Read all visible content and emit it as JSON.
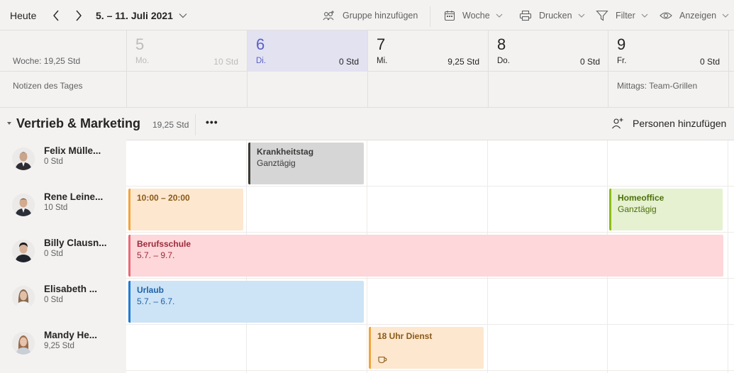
{
  "toolbar": {
    "today_label": "Heute",
    "date_range": "5. – 11. Juli 2021",
    "add_group_label": "Gruppe hinzufügen",
    "view_label": "Woche",
    "print_label": "Drucken",
    "filter_label": "Filter",
    "display_label": "Anzeigen"
  },
  "header": {
    "week_summary": "Woche: 19,25 Std",
    "notes_label": "Notizen des Tages",
    "days": [
      {
        "num": "5",
        "weekday": "Mo.",
        "hours": "10 Std",
        "note": ""
      },
      {
        "num": "6",
        "weekday": "Di.",
        "hours": "0 Std",
        "note": ""
      },
      {
        "num": "7",
        "weekday": "Mi.",
        "hours": "9,25 Std",
        "note": ""
      },
      {
        "num": "8",
        "weekday": "Do.",
        "hours": "0 Std",
        "note": ""
      },
      {
        "num": "9",
        "weekday": "Fr.",
        "hours": "0 Std",
        "note": "Mittags: Team-Grillen"
      }
    ]
  },
  "group": {
    "title": "Vertrieb & Marketing",
    "hours": "19,25 Std",
    "more_label": "•••",
    "add_people_label": "Personen hinzufügen"
  },
  "people": [
    {
      "name": "Felix Mülle...",
      "hours": "0 Std"
    },
    {
      "name": "Rene Leine...",
      "hours": "10 Std"
    },
    {
      "name": "Billy Clausn...",
      "hours": "0 Std"
    },
    {
      "name": "Elisabeth ...",
      "hours": "0 Std"
    },
    {
      "name": "Mandy He...",
      "hours": "9,25 Std"
    }
  ],
  "shifts": {
    "felix_sick": {
      "title": "Krankheitstag",
      "sub": "Ganztägig"
    },
    "rene_shift": {
      "title": "10:00 – 20:00"
    },
    "rene_homeoffice": {
      "title": "Homeoffice",
      "sub": "Ganztägig"
    },
    "billy_school": {
      "title": "Berufsschule",
      "sub": "5.7. – 9.7."
    },
    "elisabeth_vacation": {
      "title": "Urlaub",
      "sub": "5.7. – 6.7."
    },
    "mandy_shift": {
      "title": "18 Uhr Dienst",
      "icon": "coffee-cup-icon"
    }
  },
  "colors": {
    "accent": "#5b5fc7",
    "sick": "#d6d6d6",
    "orange": "#fde7cf",
    "green": "#e5f1d0",
    "red": "#fdd7d9",
    "blue": "#cde3f6"
  }
}
